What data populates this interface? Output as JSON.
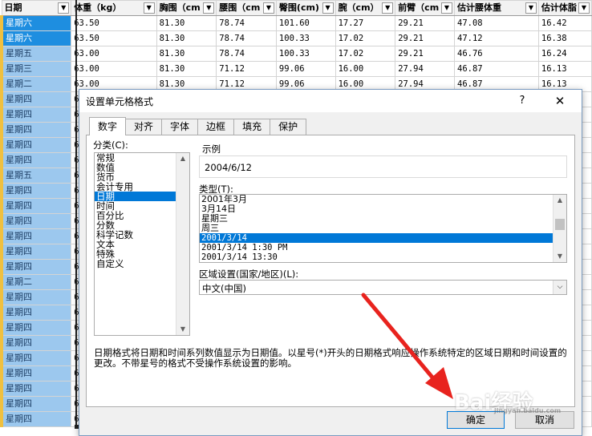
{
  "sheet": {
    "headers": [
      "日期",
      "体重（kg）",
      "胸围（cm",
      "腰围（cm",
      "臀围(cm)",
      "腕（cm）",
      "前臂（cm",
      "估计腰体重",
      "估计体脂"
    ],
    "rows": [
      [
        "星期六",
        "63.50",
        "81.30",
        "78.74",
        "101.60",
        "17.27",
        "29.21",
        "47.08",
        "16.42"
      ],
      [
        "星期六",
        "63.50",
        "81.30",
        "78.74",
        "100.33",
        "17.02",
        "29.21",
        "47.12",
        "16.38"
      ],
      [
        "星期五",
        "63.00",
        "81.30",
        "78.74",
        "100.33",
        "17.02",
        "29.21",
        "46.76",
        "16.24"
      ],
      [
        "星期三",
        "63.00",
        "81.30",
        "71.12",
        "99.06",
        "16.00",
        "27.94",
        "46.87",
        "16.13"
      ],
      [
        "星期二",
        "63.00",
        "81.30",
        "71.12",
        "99.06",
        "16.00",
        "27.94",
        "46.87",
        "16.13"
      ],
      [
        "星期四",
        "6"
      ],
      [
        "星期四",
        "6"
      ],
      [
        "星期四",
        "6"
      ],
      [
        "星期四",
        "6"
      ],
      [
        "星期四",
        "6"
      ],
      [
        "星期五",
        "6"
      ],
      [
        "星期四",
        "6"
      ],
      [
        "星期四",
        "6"
      ],
      [
        "星期四",
        "6"
      ],
      [
        "星期四",
        "6"
      ],
      [
        "星期四",
        "6"
      ],
      [
        "星期四",
        "6"
      ],
      [
        "星期二",
        "6"
      ],
      [
        "星期四",
        "6"
      ],
      [
        "星期四",
        "6"
      ],
      [
        "星期四",
        "6"
      ],
      [
        "星期四",
        "6"
      ],
      [
        "星期四",
        "6"
      ],
      [
        "星期四",
        "6"
      ],
      [
        "星期四",
        "6"
      ],
      [
        "星期四",
        "6"
      ],
      [
        "星期四",
        "6"
      ]
    ],
    "selected_day_rows": [
      0,
      1
    ],
    "colors": {
      "header_bg": "#f2f2f2",
      "day_bg": "#9cc8ee",
      "day_selected": "#1e8ee0",
      "row_marker": "#f0c040"
    }
  },
  "dialog": {
    "title": "设置单元格格式",
    "help_icon": "?",
    "close_icon": "✕",
    "tabs": [
      "数字",
      "对齐",
      "字体",
      "边框",
      "填充",
      "保护"
    ],
    "active_tab": 0,
    "category_label": "分类(C):",
    "categories": [
      "常规",
      "数值",
      "货币",
      "会计专用",
      "日期",
      "时间",
      "百分比",
      "分数",
      "科学记数",
      "文本",
      "特殊",
      "自定义"
    ],
    "selected_category": 4,
    "sample_label": "示例",
    "sample_value": "2004/6/12",
    "type_label": "类型(T):",
    "types": [
      "2001年3月",
      "3月14日",
      "星期三",
      "周三",
      "2001/3/14",
      "2001/3/14 1:30 PM",
      "2001/3/14 13:30"
    ],
    "selected_type": 4,
    "region_label": "区域设置(国家/地区)(L):",
    "region_value": "中文(中国)",
    "description": "日期格式将日期和时间系列数值显示为日期值。以星号(*)开头的日期格式响应操作系统特定的区域日期和时间设置的更改。不带星号的格式不受操作系统设置的影响。",
    "ok_label": "确定",
    "cancel_label": "取消",
    "accent_color": "#0078d7"
  },
  "annotation": {
    "arrow_color": "#e8231e"
  },
  "watermark": {
    "text": "Bai经验",
    "sub": "jingyan.baidu.com"
  }
}
